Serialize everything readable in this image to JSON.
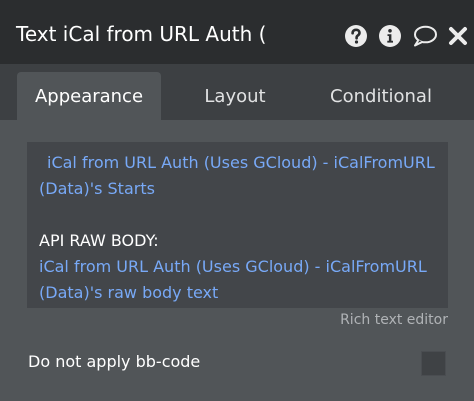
{
  "window": {
    "title": "Text iCal from URL Auth (",
    "icons": [
      "help-icon",
      "info-icon",
      "comment-icon",
      "close-icon"
    ]
  },
  "tabs": {
    "appearance": "Appearance",
    "layout": "Layout",
    "conditional": "Conditional",
    "active": "Appearance"
  },
  "editor": {
    "line1": "iCal from URL Auth (Uses GCloud) - iCalFromURL",
    "line2": "(Data)'s Starts",
    "line3": "API RAW BODY:",
    "line4": "iCal from URL Auth (Uses GCloud) - iCalFromURL",
    "line5": "(Data)'s raw body text",
    "caption": "Rich text editor"
  },
  "options": {
    "bbcode_label": "Do not apply bb-code",
    "bbcode_checked": false
  },
  "colors": {
    "dynamic_text": "#78a9f7",
    "titlebar": "#2b2d2f",
    "panel": "#515558",
    "editor_bg": "#43464a"
  }
}
